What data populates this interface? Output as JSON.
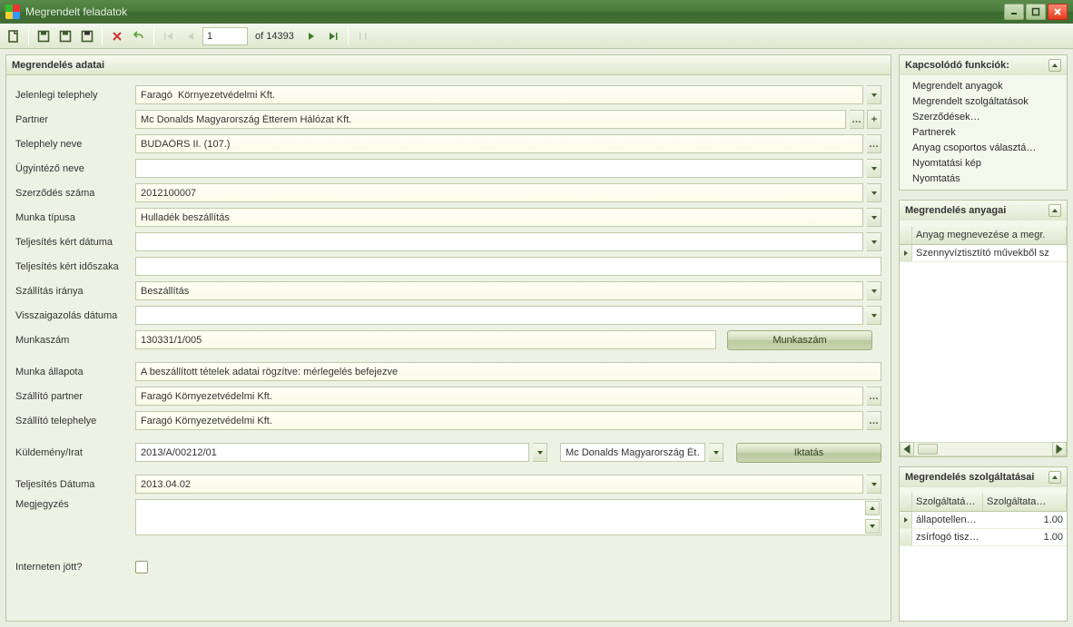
{
  "window": {
    "title": "Megrendelt feladatok"
  },
  "nav": {
    "current": "1",
    "of_label": "of 14393"
  },
  "main_group": {
    "title": "Megrendelés adatai"
  },
  "labels": {
    "jelenlegi_telephely": "Jelenlegi telephely",
    "partner": "Partner",
    "telephely_neve": "Telephely neve",
    "ugyintezo_neve": "Ügyintéző neve",
    "szerzodes_szama": "Szerződés száma",
    "munka_tipusa": "Munka típusa",
    "teljesites_kert_datuma": "Teljesítés kért dátuma",
    "teljesites_kert_idoszaka": "Teljesítés kért időszaka",
    "szallitas_iranya": "Szállítás iránya",
    "visszaigazolas_datuma": "Visszaigazolás dátuma",
    "munkaszam": "Munkaszám",
    "munka_allapota": "Munka állapota",
    "szallito_partner": "Szállító partner",
    "szallito_telephelye": "Szállító telephelye",
    "kuldemeny_irat": "Küldemény/Irat",
    "teljesites_datuma": "Teljesítés Dátuma",
    "megjegyzes": "Megjegyzés",
    "interneten_jott": "Interneten jött?"
  },
  "values": {
    "jelenlegi_telephely": "Faragó  Környezetvédelmi Kft.",
    "partner": "Mc Donalds Magyarország Étterem Hálózat Kft.",
    "telephely_neve": "BUDAÖRS II. (107.)",
    "ugyintezo_neve": "",
    "szerzodes_szama": "2012100007",
    "munka_tipusa": "Hulladék beszállítás",
    "teljesites_kert_datuma": "",
    "teljesites_kert_idoszaka": "",
    "szallitas_iranya": "Beszállítás",
    "visszaigazolas_datuma": "",
    "munkaszam": "130331/1/005",
    "munka_allapota": "A beszállított tételek adatai rögzítve: mérlegelés befejezve",
    "szallito_partner": "Faragó Környezetvédelmi Kft.",
    "szallito_telephelye": "Faragó Környezetvédelmi Kft.",
    "kuldemeny_irat": "2013/A/00212/01",
    "kuldemeny_partner": "Mc Donalds Magyarország Ét…",
    "teljesites_datuma": "2013.04.02",
    "megjegyzes": ""
  },
  "buttons": {
    "munkaszam": "Munkaszám",
    "iktatas": "Iktatás"
  },
  "related": {
    "title": "Kapcsolódó funkciók:",
    "items": [
      "Megrendelt anyagok",
      "Megrendelt szolgáltatások",
      "Szerződések…",
      "Partnerek",
      "Anyag csoportos választá…",
      "Nyomtatási kép",
      "Nyomtatás"
    ]
  },
  "anyag_panel": {
    "title": "Megrendelés anyagai",
    "col1": "Anyag megnevezése a megr.",
    "rows": [
      {
        "c1": "Szennyvíztisztító művekből sz"
      }
    ]
  },
  "szolg_panel": {
    "title": "Megrendelés szolgáltatásai",
    "col1": "Szolgáltatá…",
    "col2": "Szolgáltata…",
    "rows": [
      {
        "c1": "állapotellen…",
        "c2": "1.00"
      },
      {
        "c1": "zsírfogó tisz…",
        "c2": "1.00"
      }
    ]
  }
}
